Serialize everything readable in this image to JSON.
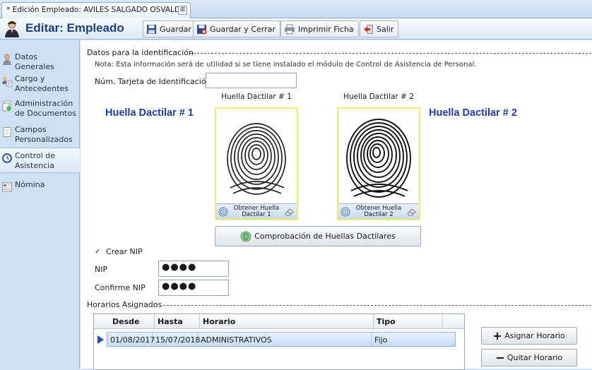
{
  "document_tab": {
    "title": "* Edición Empleado: AVILES SALGADO OSVALDO",
    "close_glyph": "⊠"
  },
  "toolbar": {
    "title": "Editar: Empleado",
    "save_label": "Guardar",
    "save_close_label": "Guardar y Cerrar",
    "print_label": "Imprimir Ficha",
    "exit_label": "Salir"
  },
  "sidebar": {
    "items": [
      {
        "label": "Datos Generales",
        "icon": "person-icon"
      },
      {
        "label": "Cargo y Antecedentes",
        "icon": "id-card-icon"
      },
      {
        "label": "Administración de Documentos",
        "icon": "documents-icon"
      },
      {
        "label": "Campos Personalizados",
        "icon": "form-icon"
      },
      {
        "label": "Control de Asistencia",
        "icon": "clock-icon"
      },
      {
        "label": "Nómina",
        "icon": "payroll-icon"
      }
    ],
    "active_index": 4
  },
  "identification": {
    "header": "Datos para la identificación",
    "note": "Nota: Esta información será de utilidad si se tiene instalado el módulo de Control de Asistencia de Personal.",
    "card_label": "Núm. Tarjeta de Identificación",
    "card_value": "",
    "fingerprint1": {
      "big_title": "Huella Dactilar # 1",
      "caption": "Huella Dactilar # 1",
      "button_label": "Obtener Huella Dactilar 1"
    },
    "fingerprint2": {
      "big_title": "Huella Dactilar # 2",
      "caption": "Huella Dactilar # 2",
      "button_label": "Obtener Huella Dactilar 2"
    },
    "check_button_label": "Comprobación de Huellas Dactilares",
    "create_nip_label": "Crear NIP",
    "create_nip_checked": true,
    "check_glyph": "✓",
    "nip_label": "NIP",
    "nip_value": "●●●●",
    "confirm_nip_label": "Confirme NIP",
    "confirm_nip_value": "●●●●"
  },
  "schedules": {
    "header": "Horarios Asignados",
    "columns": [
      "Desde",
      "Hasta",
      "Horario",
      "Tipo"
    ],
    "rows": [
      {
        "desde": "01/08/2017",
        "hasta": "15/07/2018",
        "horario": "ADMINISTRATIVOS",
        "tipo": "Fijo"
      }
    ],
    "assign_label": "Asignar Horario",
    "remove_label": "Quitar Horario"
  },
  "colors": {
    "accent_title": "#1d3f7a",
    "fingerprint_title": "#1f3aa8",
    "fingerprint_border": "#f2ea6a",
    "selected_row": "#c9dcf3"
  }
}
